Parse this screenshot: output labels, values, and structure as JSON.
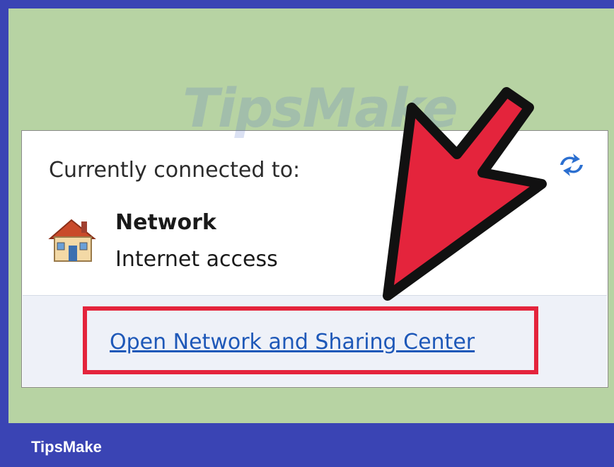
{
  "popup": {
    "heading": "Currently connected to:",
    "network_name": "Network",
    "network_status": "Internet access",
    "link_label": "Open Network and Sharing Center",
    "icons": [
      "house-icon",
      "refresh-icon"
    ]
  },
  "watermark": "TipsMake",
  "footer": {
    "brand": "TipsMake"
  },
  "colors": {
    "border": "#3a44b4",
    "background": "#b7d3a3",
    "arrow": "#e4243c",
    "link": "#1e58b8"
  }
}
